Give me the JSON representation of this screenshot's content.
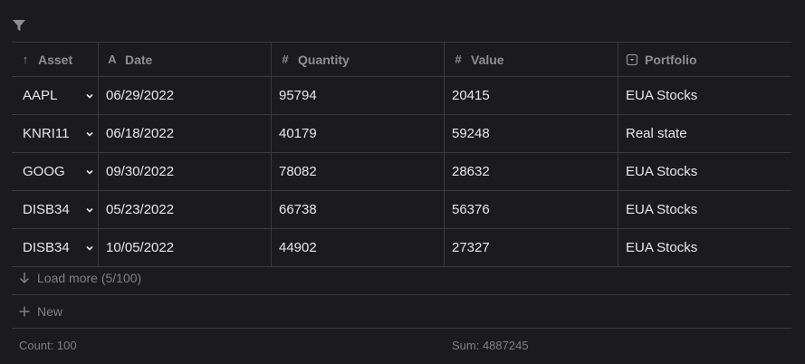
{
  "toolbar": {
    "filter_icon": "filter-icon"
  },
  "columns": [
    {
      "label": "Asset",
      "icon": "sort-arrow-up-icon",
      "glyph": "↑"
    },
    {
      "label": "Date",
      "icon": "text-type-icon",
      "glyph": "A"
    },
    {
      "label": "Quantity",
      "icon": "number-icon",
      "glyph": "#"
    },
    {
      "label": "Value",
      "icon": "number-icon",
      "glyph": "#"
    },
    {
      "label": "Portfolio",
      "icon": "select-icon",
      "glyph": "▾"
    }
  ],
  "rows": [
    {
      "asset": "AAPL",
      "date": "06/29/2022",
      "quantity": "95794",
      "value": "20415",
      "portfolio": "EUA Stocks"
    },
    {
      "asset": "KNRI11",
      "date": "06/18/2022",
      "quantity": "40179",
      "value": "59248",
      "portfolio": "Real state"
    },
    {
      "asset": "GOOG",
      "date": "09/30/2022",
      "quantity": "78082",
      "value": "28632",
      "portfolio": "EUA Stocks"
    },
    {
      "asset": "DISB34",
      "date": "05/23/2022",
      "quantity": "66738",
      "value": "56376",
      "portfolio": "EUA Stocks"
    },
    {
      "asset": "DISB34",
      "date": "10/05/2022",
      "quantity": "44902",
      "value": "27327",
      "portfolio": "EUA Stocks"
    }
  ],
  "load_more": {
    "label": "Load more (5/100)"
  },
  "new_row": {
    "label": "New"
  },
  "summary": {
    "count": "Count: 100",
    "sum": "Sum: 4887245"
  },
  "colors": {
    "background": "#1b1b1d",
    "border": "#3a3a3e",
    "muted": "#8d8d93",
    "text": "#e8e8ea"
  }
}
